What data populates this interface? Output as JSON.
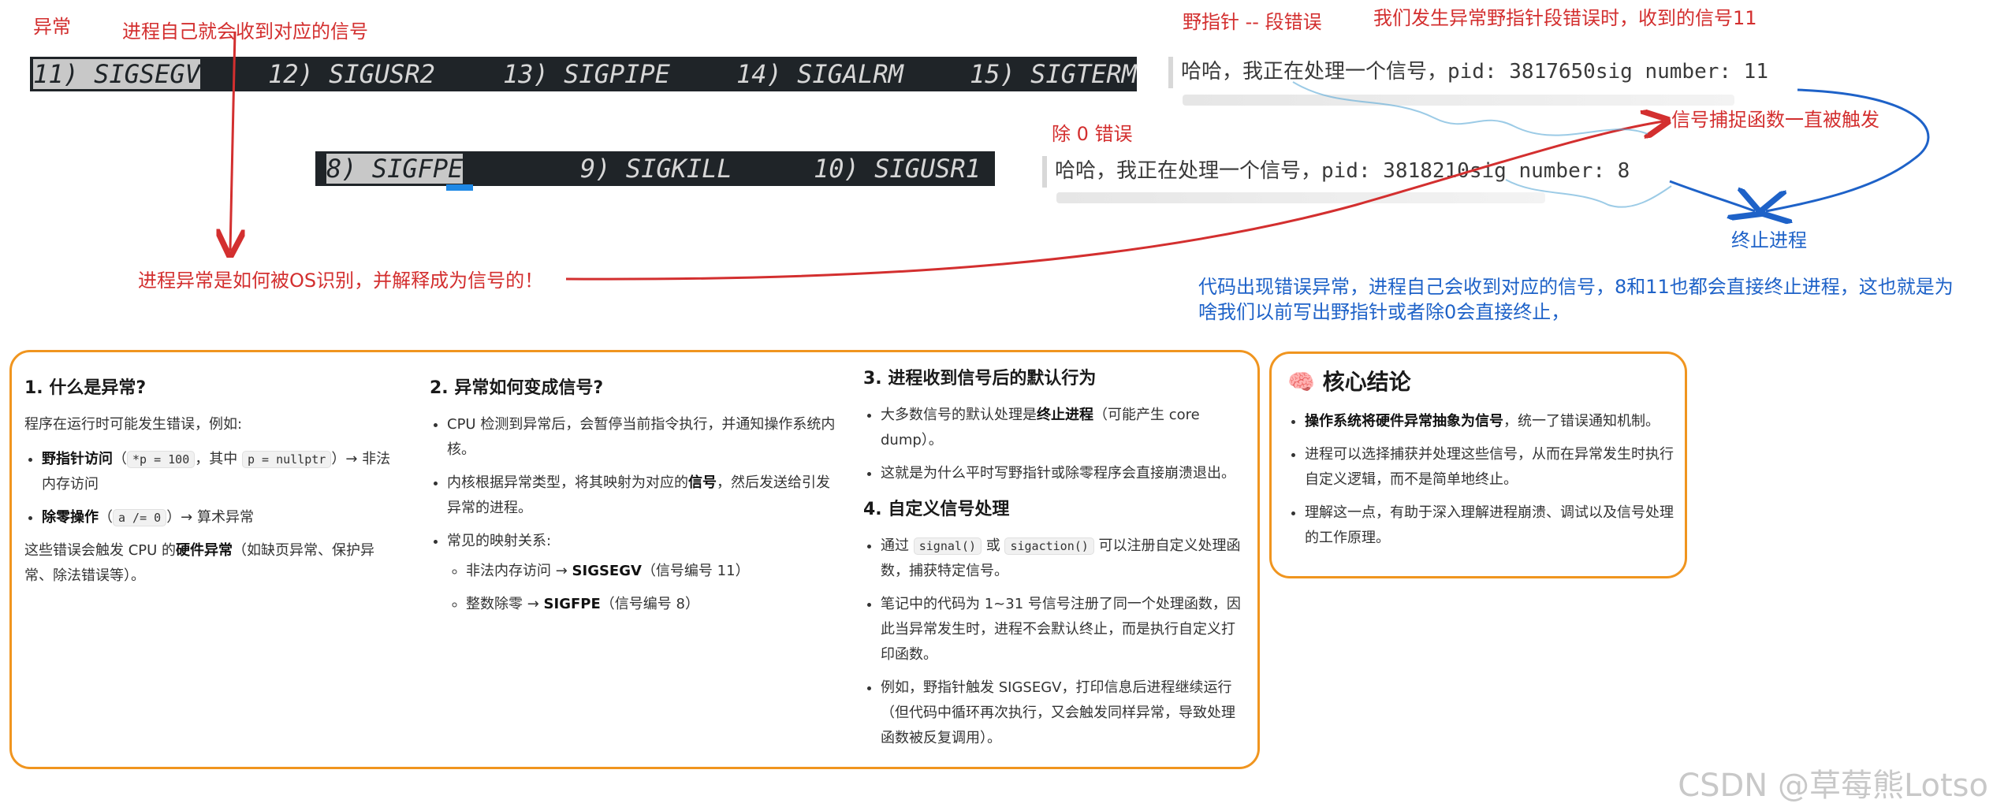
{
  "annotations": {
    "abnormal": "异常",
    "self_receive": "进程自己就会收到对应的信号",
    "wild_pointer": "野指针 -- 段错误",
    "segfault_signal": "我们发生异常野指针段错误时，收到的信号11",
    "div_zero": "除 0 错误",
    "handler_triggered": "信号捕捉函数一直被触发",
    "terminate": "终止进程",
    "how_recognized": "进程异常是如何被OS识别，并解释成为信号的！",
    "explain_line1": "代码出现错误异常，进程自己会收到对应的信号，8和11也都会直接终止进程，这也就是为",
    "explain_line2": "啥我们以前写出野指针或者除0会直接终止，"
  },
  "terminal_top": [
    "11) SIGSEGV",
    "12) SIGUSR2",
    "13) SIGPIPE",
    "14) SIGALRM",
    "15) SIGTERM"
  ],
  "terminal_mid": [
    "8) SIGFPE",
    "9) SIGKILL",
    "10) SIGUSR1"
  ],
  "output_top": "哈哈，我正在处理一个信号，pid: 3817650sig number: 11",
  "output_mid": "哈哈，我正在处理一个信号，pid: 3818210sig number: 8",
  "notes": {
    "col1": {
      "title": "1. 什么是异常?",
      "intro": "程序在运行时可能发生错误，例如:",
      "item1_bold": "野指针访问",
      "item1_code1": "*p = 100",
      "item1_mid": "，其中",
      "item1_code2": "p = nullptr",
      "item1_tail": "）→ 非法内存访问",
      "item2_bold": "除零操作",
      "item2_code": "a /= 0",
      "item2_tail": "）→ 算术异常",
      "outro_pre": "这些错误会触发 CPU 的",
      "outro_bold": "硬件异常",
      "outro_tail": "（如缺页异常、保护异常、除法错误等）。"
    },
    "col2": {
      "title": "2. 异常如何变成信号?",
      "item1": "CPU 检测到异常后，会暂停当前指令执行，并通知操作系统内核。",
      "item2_pre": "内核根据异常类型，将其映射为对应的",
      "item2_bold": "信号",
      "item2_tail": "，然后发送给引发异常的进程。",
      "item3": "常见的映射关系:",
      "sub1_pre": "非法内存访问 → ",
      "sub1_bold": "SIGSEGV",
      "sub1_tail": "（信号编号 11）",
      "sub2_pre": "整数除零 → ",
      "sub2_bold": "SIGFPE",
      "sub2_tail": "（信号编号 8）"
    },
    "col3": {
      "title3": "3. 进程收到信号后的默认行为",
      "a1_pre": "大多数信号的默认处理是",
      "a1_bold": "终止进程",
      "a1_tail": "（可能产生 core dump）。",
      "a2": "这就是为什么平时写野指针或除零程序会直接崩溃退出。",
      "title4": "4. 自定义信号处理",
      "b1_pre": "通过",
      "b1_code1": "signal()",
      "b1_or": "或",
      "b1_code2": "sigaction()",
      "b1_tail": "可以注册自定义处理函数，捕获特定信号。",
      "b2": "笔记中的代码为 1~31 号信号注册了同一个处理函数，因此当异常发生时，进程不会默认终止，而是执行自定义打印函数。",
      "b3": "例如，野指针触发 SIGSEGV，打印信息后进程继续运行（但代码中循环再次执行，又会触发同样异常，导致处理函数被反复调用）。"
    },
    "conclusion": {
      "icon": "🧠",
      "title": "核心结论",
      "c1_bold": "操作系统将硬件异常抽象为信号",
      "c1_tail": "，统一了错误通知机制。",
      "c2": "进程可以选择捕获并处理这些信号，从而在异常发生时执行自定义逻辑，而不是简单地终止。",
      "c3": "理解这一点，有助于深入理解进程崩溃、调试以及信号处理的工作原理。"
    }
  },
  "watermark": "CSDN @草莓熊Lotso",
  "colors": {
    "red": "#d32f2f",
    "blue": "#1e62c8",
    "orange": "#f0951f",
    "terminal": "#1f2428"
  }
}
